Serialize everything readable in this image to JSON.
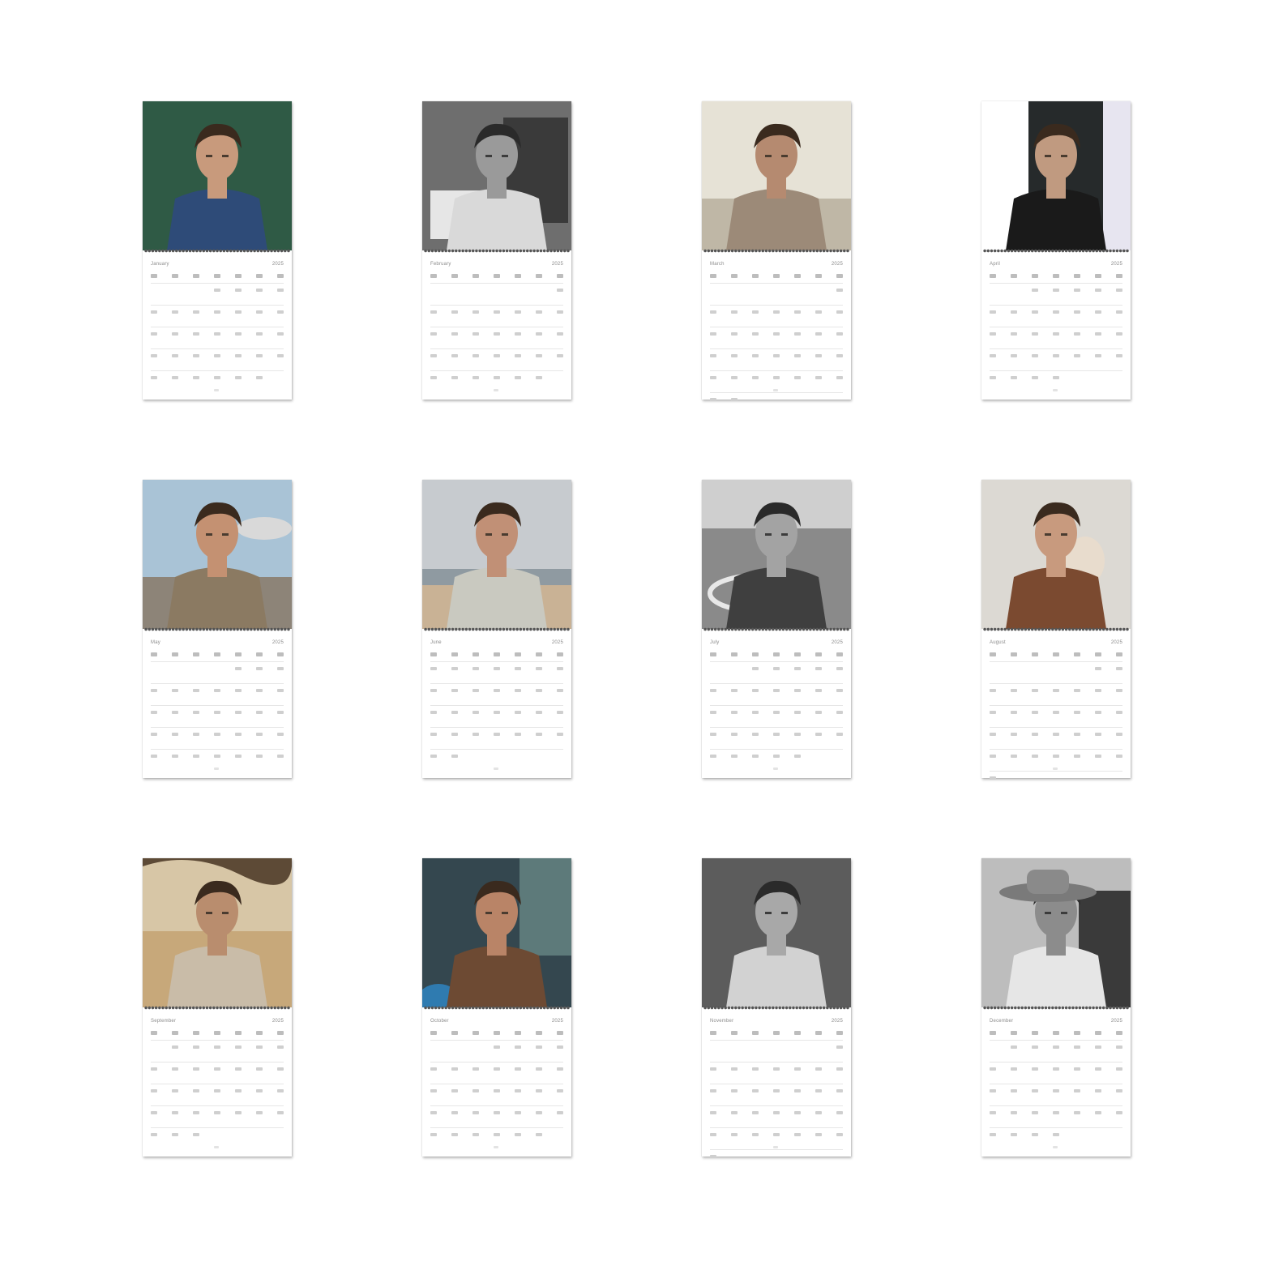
{
  "calendar": {
    "months": [
      {
        "name": "January",
        "year": "2025"
      },
      {
        "name": "February",
        "year": "2025"
      },
      {
        "name": "March",
        "year": "2025"
      },
      {
        "name": "April",
        "year": "2025"
      },
      {
        "name": "May",
        "year": "2025"
      },
      {
        "name": "June",
        "year": "2025"
      },
      {
        "name": "July",
        "year": "2025"
      },
      {
        "name": "August",
        "year": "2025"
      },
      {
        "name": "September",
        "year": "2025"
      },
      {
        "name": "October",
        "year": "2025"
      },
      {
        "name": "November",
        "year": "2025"
      },
      {
        "name": "December",
        "year": "2025"
      }
    ]
  },
  "photos": [
    {
      "scene": "man-green-backdrop",
      "bg": "#2f5a45",
      "shirt": "#2e4b78",
      "skin": "#c89a7c",
      "bw": false
    },
    {
      "scene": "man-tank-top-newspaper",
      "bg": "#6e6e6e",
      "shirt": "#d9d9d9",
      "skin": "#9a9a9a",
      "bw": true
    },
    {
      "scene": "man-linen-suit",
      "bg": "#d8d4c6",
      "shirt": "#9c8a78",
      "skin": "#b58a70",
      "bw": false
    },
    {
      "scene": "man-doorway",
      "bg": "#2c2f30",
      "shirt": "#1a1a1a",
      "skin": "#c09a80",
      "bw": false
    },
    {
      "scene": "man-airfield-tshirt",
      "bg": "#a9c3d6",
      "shirt": "#8b7a62",
      "skin": "#c49172",
      "bw": false
    },
    {
      "scene": "man-jumping-road",
      "bg": "#c7cbcf",
      "shirt": "#c9c9c0",
      "skin": "#c19076",
      "bw": false
    },
    {
      "scene": "man-driving-car",
      "bg": "#8a8a8a",
      "shirt": "#3f3f3f",
      "skin": "#a3a3a3",
      "bw": true
    },
    {
      "scene": "man-with-dog",
      "bg": "#dcd9d3",
      "shirt": "#7b4a30",
      "skin": "#c89a7e",
      "bw": false
    },
    {
      "scene": "man-vest-field",
      "bg": "#d7c6a6",
      "shirt": "#c9bca8",
      "skin": "#b98d6e",
      "bw": false
    },
    {
      "scene": "man-leather-jacket",
      "bg": "#34474f",
      "shirt": "#6d4a33",
      "skin": "#b98467",
      "bw": false
    },
    {
      "scene": "man-portrait-bw",
      "bg": "#5c5c5c",
      "shirt": "#d2d2d2",
      "skin": "#a8a8a8",
      "bw": true
    },
    {
      "scene": "man-cowboy-hat",
      "bg": "#bdbdbd",
      "shirt": "#e6e6e6",
      "skin": "#8c8c8c",
      "bw": true
    }
  ]
}
